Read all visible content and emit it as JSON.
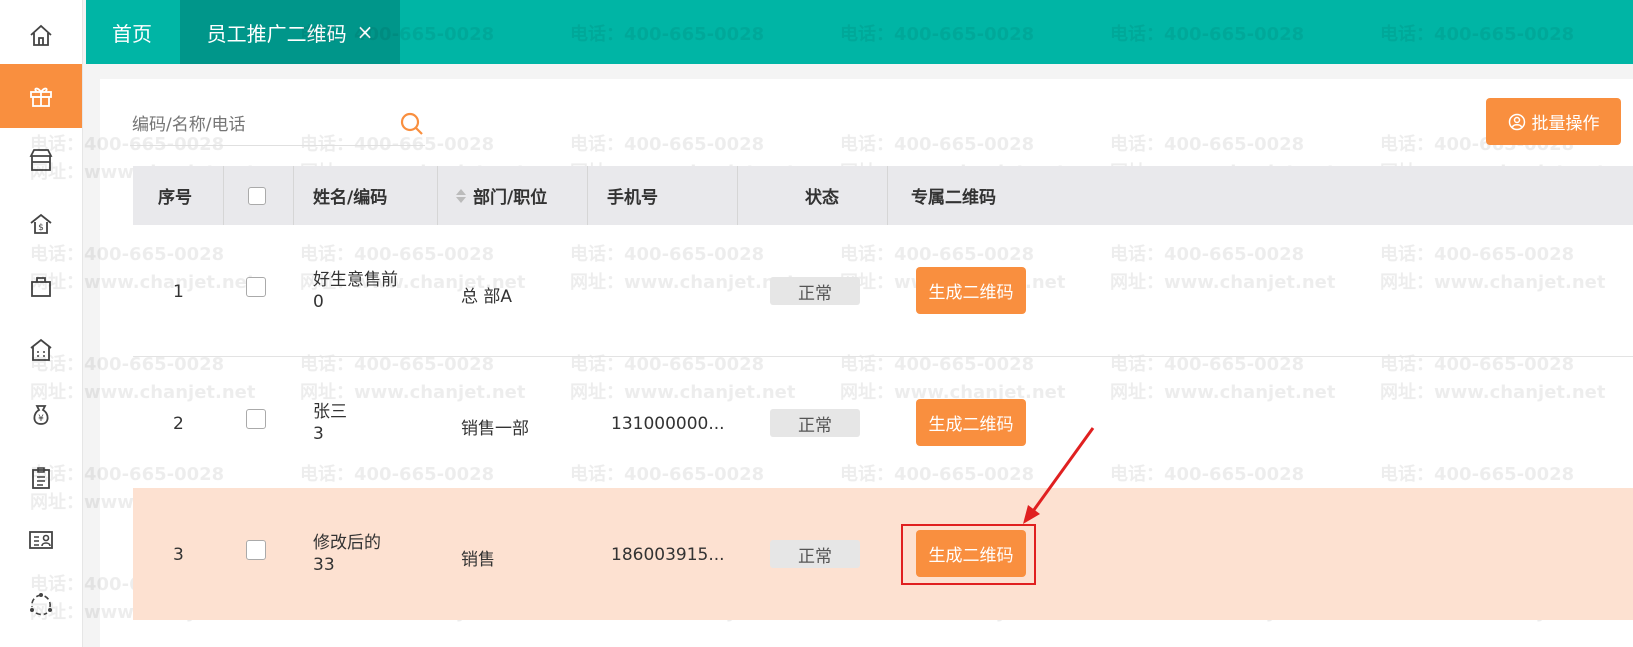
{
  "topbar": {
    "home_tab": "首页",
    "current_tab": "员工推广二维码",
    "close_glyph": "×"
  },
  "sidebar": {
    "items": [
      {
        "icon": "home-icon"
      },
      {
        "icon": "gift-icon",
        "active": true
      },
      {
        "icon": "store-icon"
      },
      {
        "icon": "money-bag-house-icon"
      },
      {
        "icon": "shopping-bag-icon"
      },
      {
        "icon": "building-icon"
      },
      {
        "icon": "money-bag-icon"
      },
      {
        "icon": "clipboard-icon"
      },
      {
        "icon": "id-card-icon"
      },
      {
        "icon": "share-icon"
      }
    ]
  },
  "search": {
    "placeholder": "编码/名称/电话"
  },
  "batch_button": {
    "label": "批量操作"
  },
  "table": {
    "headers": {
      "index": "序号",
      "name": "姓名/编码",
      "dept": "部门/职位",
      "phone": "手机号",
      "status": "状态",
      "qrcode": "专属二维码"
    },
    "rows": [
      {
        "index": "1",
        "name": "好生意售前",
        "code": "0",
        "dept": "总 部A",
        "phone": "",
        "status": "正常",
        "action": "生成二维码"
      },
      {
        "index": "2",
        "name": "张三",
        "code": "3",
        "dept": "销售一部",
        "phone": "131000000...",
        "status": "正常",
        "action": "生成二维码"
      },
      {
        "index": "3",
        "name": "修改后的",
        "code": "33",
        "dept": "销售",
        "phone": "186003915...",
        "status": "正常",
        "action": "生成二维码"
      }
    ]
  },
  "watermark": {
    "line1": "电话：400-665-0028",
    "line2": "网址：www.chanjet.net"
  },
  "colors": {
    "teal": "#00b5a5",
    "teal_dark": "#00968a",
    "orange": "#f98f3f",
    "highlight_row": "#fde1d1",
    "annotation_red": "#e02020"
  }
}
